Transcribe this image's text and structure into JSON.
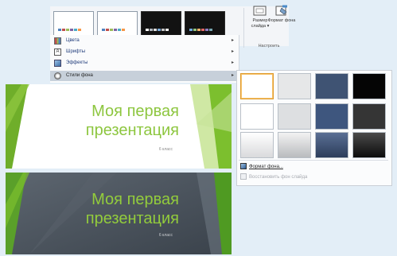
{
  "ribbon": {
    "slide_size_label": "Размер слайда",
    "slide_size_suffix": "▾",
    "format_bg_label": "Формат фона",
    "group_label": "Настроить",
    "variants": [
      {
        "style": "white",
        "dots": [
          "#4f81bd",
          "#c0504d",
          "#9bbb59",
          "#8064a2",
          "#4bacc6",
          "#f79646"
        ]
      },
      {
        "style": "white",
        "dots": [
          "#4f81bd",
          "#c0504d",
          "#9bbb59",
          "#8064a2",
          "#4bacc6",
          "#f79646"
        ]
      },
      {
        "style": "dark",
        "dots": [
          "#ffffff",
          "#aeb4bc",
          "#e0e0e0",
          "#7aa9d6",
          "#c3c3c3",
          "#f0f0f0"
        ]
      },
      {
        "style": "dark",
        "dots": [
          "#6fa8dc",
          "#93c47d",
          "#f6b26b",
          "#e06666",
          "#8e7cc3",
          "#76a5af"
        ]
      }
    ]
  },
  "menu": {
    "items": [
      {
        "label": "Цвета",
        "icon": "colors-icon"
      },
      {
        "label": "Шрифты",
        "icon": "fonts-icon"
      },
      {
        "label": "Эффекты",
        "icon": "effects-icon"
      },
      {
        "label": "Стили фона",
        "icon": "background-styles-icon"
      }
    ],
    "arrow": "▸"
  },
  "slides": [
    {
      "title_line1": "Моя первая",
      "title_line2": "презентация",
      "subtitle": "6 класс",
      "theme": "light"
    },
    {
      "title_line1": "Моя первая",
      "title_line2": "презентация",
      "subtitle": "6 класс",
      "theme": "dark"
    }
  ],
  "gallery": {
    "swatches": [
      {
        "fill": "#ffffff",
        "selected": true
      },
      {
        "fill": "#e6e7e8"
      },
      {
        "fill": "#3f5373"
      },
      {
        "fill": "#050505"
      },
      {
        "fill": "#ffffff"
      },
      {
        "fill": "#dddfe1"
      },
      {
        "fill": "#3e567e"
      },
      {
        "fill": "#353535"
      },
      {
        "fill": "gradient-white"
      },
      {
        "fill": "gradient-gray"
      },
      {
        "fill": "gradient-blue"
      },
      {
        "fill": "gradient-black"
      }
    ],
    "format_background_link": "Формат фона...",
    "reset_background_link": "Восстановить фон слайда"
  },
  "colors": {
    "accent_green": "#8dc63f",
    "menu_active": "#c7d0da",
    "page_bg": "#e3eef7"
  }
}
